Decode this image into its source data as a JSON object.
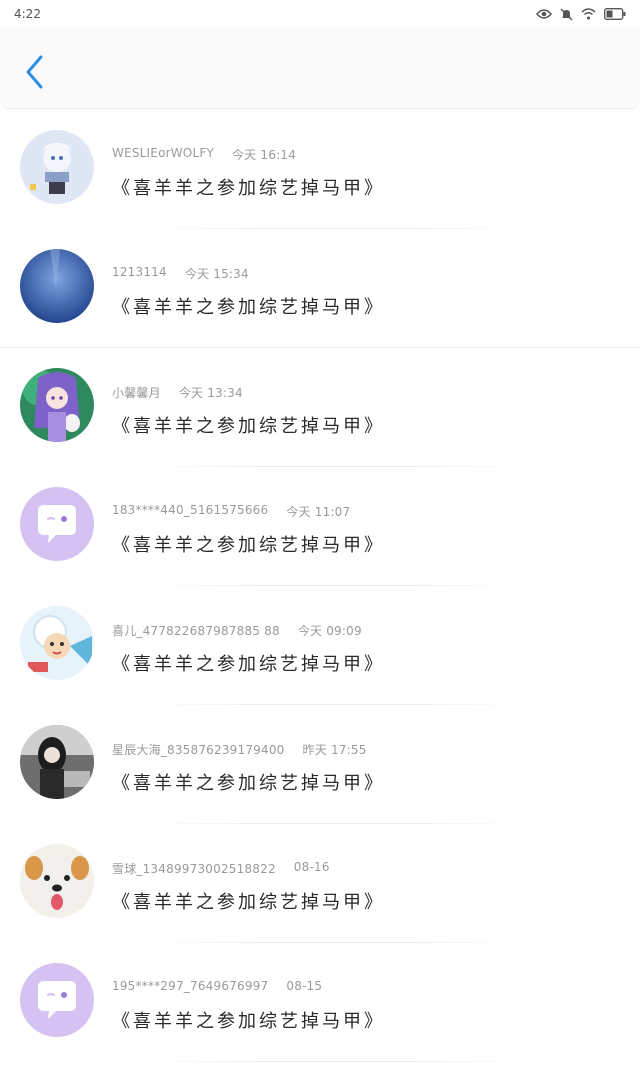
{
  "status_bar": {
    "time": "4:22"
  },
  "header": {
    "back_icon": "chevron-left-icon"
  },
  "colors": {
    "accent": "#2d8ee6",
    "default_avatar_bg": "#d5c2f2"
  },
  "items": [
    {
      "user": "WESLIEorWOLFY",
      "time": "今天 16:14",
      "title": "《喜羊羊之参加综艺掉马甲》",
      "avatar": "anime-avatar-white-hair"
    },
    {
      "user": "1213114",
      "time": "今天 15:34",
      "title": "《喜羊羊之参加综艺掉马甲》",
      "avatar": "blue-sky-avatar"
    },
    {
      "user": "小馨馨月",
      "time": "今天 13:34",
      "title": "《喜羊羊之参加综艺掉马甲》",
      "avatar": "anime-avatar-purple"
    },
    {
      "user": "183****440_5161575666",
      "time": "今天 11:07",
      "title": "《喜羊羊之参加综艺掉马甲》",
      "avatar": "default-chat-avatar"
    },
    {
      "user": "喜儿_477822687987885 88",
      "time": "今天 09:09",
      "title": "《喜羊羊之参加综艺掉马甲》",
      "avatar": "cartoon-sheep-avatar"
    },
    {
      "user": "星辰大海_835876239179400",
      "time": "昨天 17:55",
      "title": "《喜羊羊之参加综艺掉马甲》",
      "avatar": "girl-photo-avatar"
    },
    {
      "user": "雪球_13489973002518822",
      "time": "08-16",
      "title": "《喜羊羊之参加综艺掉马甲》",
      "avatar": "dog-avatar"
    },
    {
      "user": "195****297_7649676997",
      "time": "08-15",
      "title": "《喜羊羊之参加综艺掉马甲》",
      "avatar": "default-chat-avatar"
    }
  ]
}
